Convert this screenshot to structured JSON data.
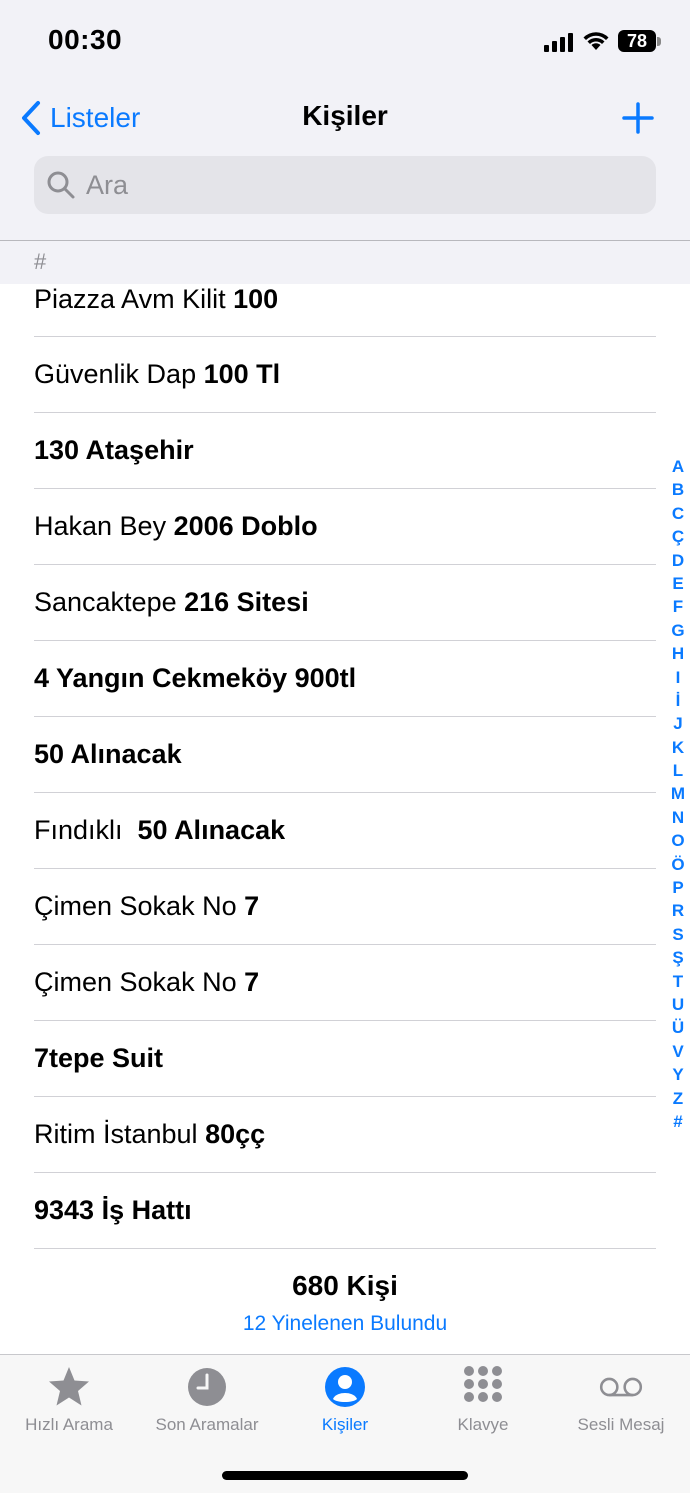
{
  "status": {
    "time": "00:30",
    "battery": "78"
  },
  "nav": {
    "back_label": "Listeler",
    "title": "Kişiler"
  },
  "search": {
    "placeholder": "Ara"
  },
  "section": {
    "label": "#"
  },
  "contacts": [
    {
      "pre": "Piazza Avm Kilit ",
      "bold": "100"
    },
    {
      "pre": "Güvenlik Dap ",
      "bold": "100 Tl"
    },
    {
      "pre": "",
      "bold": "130 Ataşehir"
    },
    {
      "pre": "Hakan Bey ",
      "bold": "2006 Doblo"
    },
    {
      "pre": "Sancaktepe ",
      "bold": "216 Sitesi"
    },
    {
      "pre": "",
      "bold": "4 Yangın Cekmeköy 900tl"
    },
    {
      "pre": "",
      "bold": "50 Alınacak"
    },
    {
      "pre": "Fındıklı  ",
      "bold": "50 Alınacak"
    },
    {
      "pre": "Çimen Sokak No ",
      "bold": "7"
    },
    {
      "pre": "Çimen Sokak No ",
      "bold": "7"
    },
    {
      "pre": "",
      "bold": "7tepe Suit"
    },
    {
      "pre": "Ritim İstanbul ",
      "bold": "80çç"
    },
    {
      "pre": "",
      "bold": "9343 İş Hattı"
    }
  ],
  "index_letters": [
    "A",
    "B",
    "C",
    "Ç",
    "D",
    "E",
    "F",
    "G",
    "H",
    "I",
    "İ",
    "J",
    "K",
    "L",
    "M",
    "N",
    "O",
    "Ö",
    "P",
    "R",
    "S",
    "Ş",
    "T",
    "U",
    "Ü",
    "V",
    "Y",
    "Z",
    "#"
  ],
  "footer": {
    "count": "680 Kişi",
    "duplicates": "12 Yinelenen Bulundu"
  },
  "tabs": [
    {
      "label": "Hızlı Arama",
      "icon": "star-icon",
      "active": false
    },
    {
      "label": "Son Aramalar",
      "icon": "clock-icon",
      "active": false
    },
    {
      "label": "Kişiler",
      "icon": "person-circle-icon",
      "active": true
    },
    {
      "label": "Klavye",
      "icon": "keypad-icon",
      "active": false
    },
    {
      "label": "Sesli Mesaj",
      "icon": "voicemail-icon",
      "active": false
    }
  ],
  "colors": {
    "accent": "#0a7aff",
    "inactive": "#8e8e93",
    "background": "#f2f2f7"
  }
}
